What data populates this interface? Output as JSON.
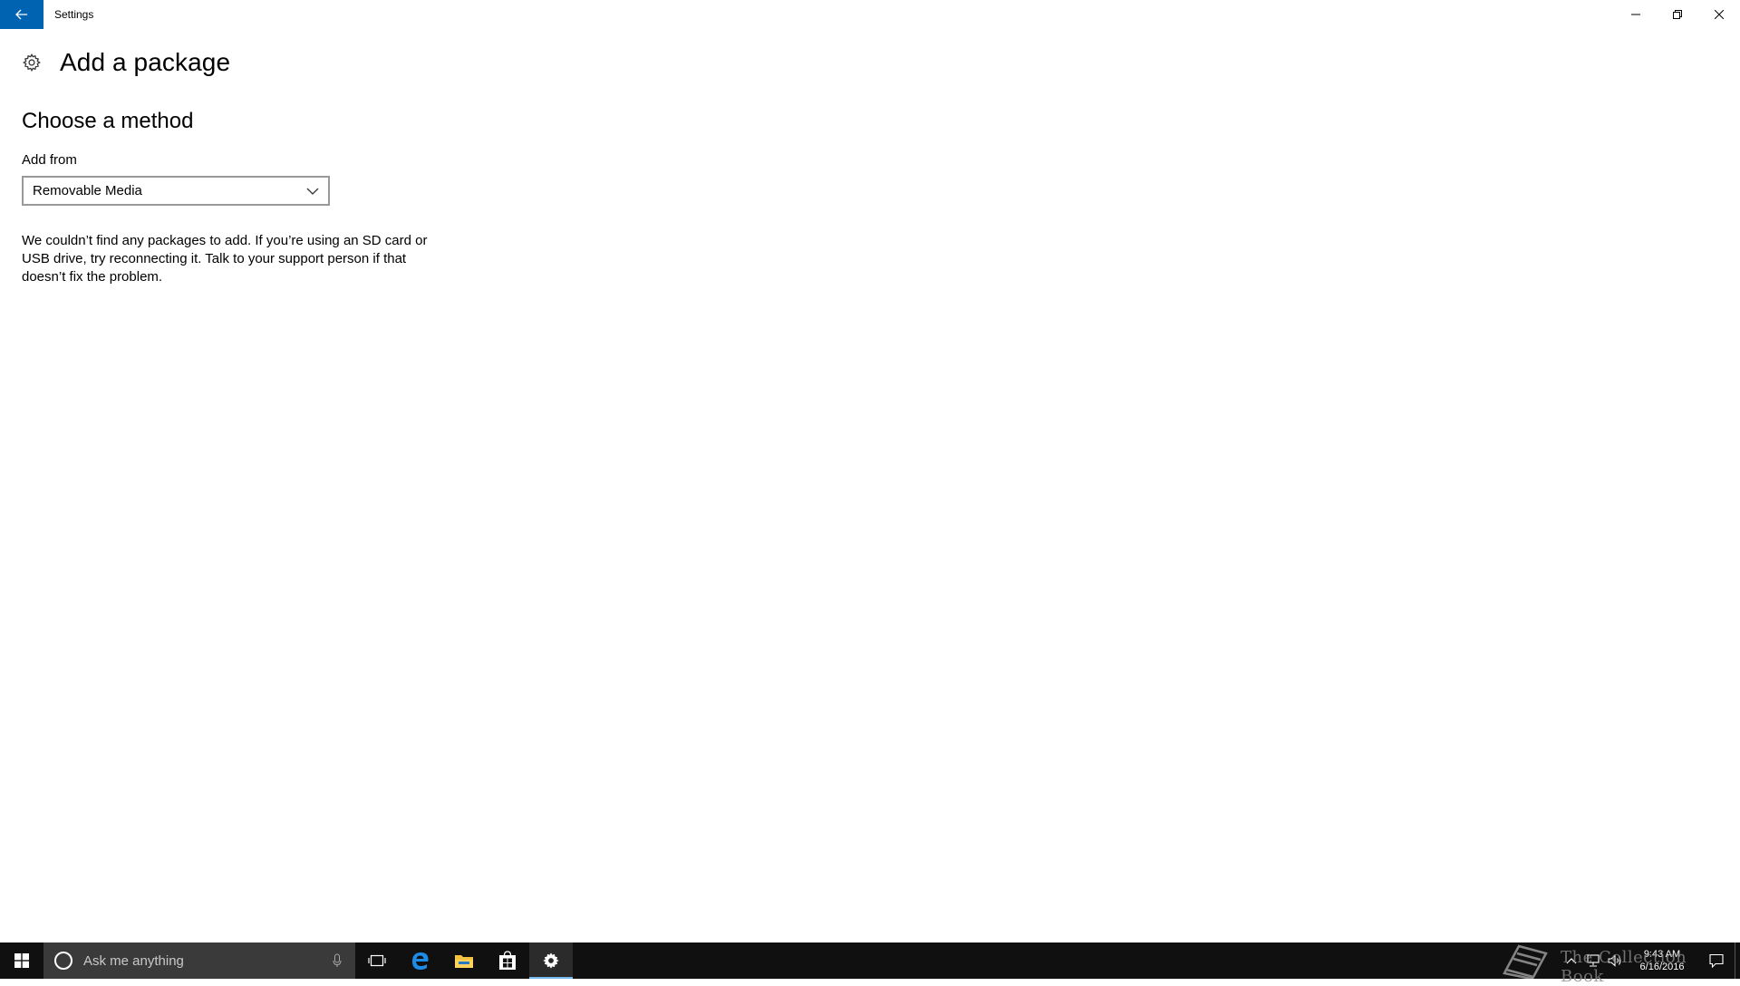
{
  "window": {
    "title": "Settings",
    "accent_color": "#0063b1"
  },
  "header": {
    "page_title": "Add a package",
    "icon": "gear-icon"
  },
  "content": {
    "section_title": "Choose a method",
    "add_from_label": "Add from",
    "add_from_selected": "Removable Media",
    "message": "We couldn’t find any packages to add. If you’re using an SD card or USB drive, try reconnecting it. Talk to your support person if that doesn’t fix the problem."
  },
  "taskbar": {
    "search_placeholder": "Ask me anything",
    "apps": [
      "task-view",
      "edge",
      "file-explorer",
      "store",
      "settings"
    ],
    "active_app": "settings",
    "clock_time": "9:43 AM",
    "clock_date": "6/16/2016",
    "watermark": "The Collection Book",
    "active_indicator_color": "#76b9ed"
  }
}
